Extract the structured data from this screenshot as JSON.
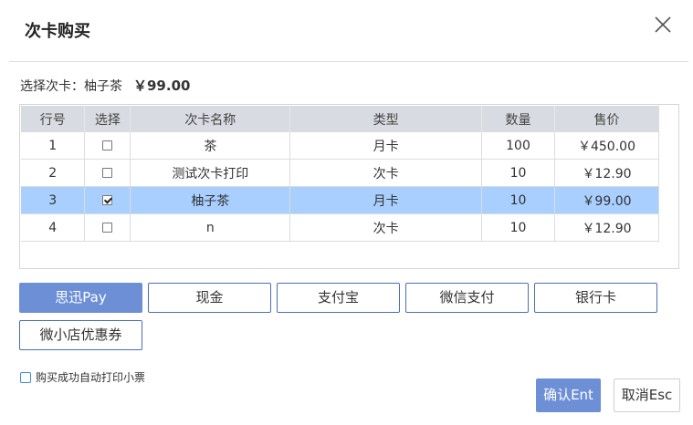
{
  "dialog": {
    "title": "次卡购买",
    "selected_label": "选择次卡：柚子茶",
    "selected_price": "￥99.00"
  },
  "table": {
    "headers": [
      "行号",
      "选择",
      "次卡名称",
      "类型",
      "数量",
      "售价"
    ],
    "rows": [
      {
        "no": "1",
        "checked": false,
        "name": "茶",
        "type": "月卡",
        "qty": "100",
        "price": "￥450.00"
      },
      {
        "no": "2",
        "checked": false,
        "name": "测试次卡打印",
        "type": "次卡",
        "qty": "10",
        "price": "￥12.90"
      },
      {
        "no": "3",
        "checked": true,
        "name": "柚子茶",
        "type": "月卡",
        "qty": "10",
        "price": "￥99.00"
      },
      {
        "no": "4",
        "checked": false,
        "name": "n",
        "type": "次卡",
        "qty": "10",
        "price": "￥12.90"
      }
    ]
  },
  "payment": {
    "methods": [
      "思迅Pay",
      "现金",
      "支付宝",
      "微信支付",
      "银行卡",
      "微小店优惠券"
    ],
    "active": "思迅Pay"
  },
  "options": {
    "auto_print_label": "购买成功自动打印小票",
    "auto_print_checked": false
  },
  "actions": {
    "confirm_label": "确认Ent",
    "cancel_label": "取消Esc"
  },
  "colors": {
    "accent": "#6d8fd6",
    "selected_row": "#a9cfff",
    "header_bg": "#d8dbe2"
  }
}
